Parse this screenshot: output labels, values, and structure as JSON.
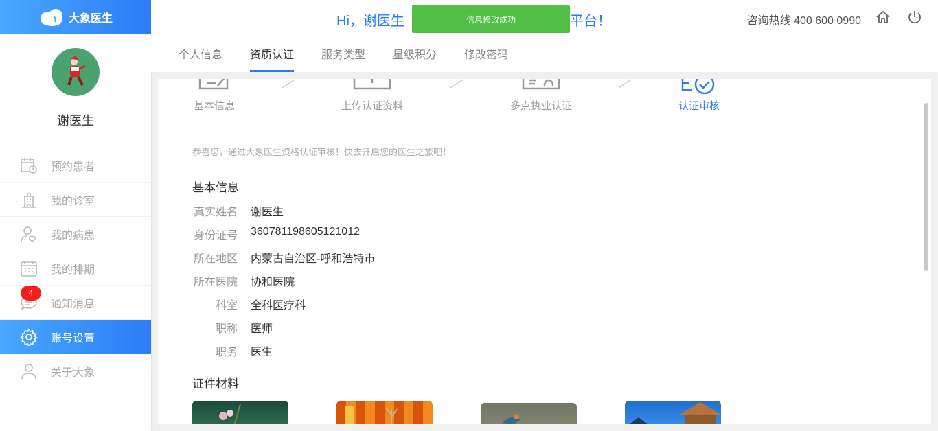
{
  "brand": {
    "name": "大象医生"
  },
  "header": {
    "greeting_left": "Hi，谢医生",
    "greeting_right": "平台！",
    "toast": "信息修改成功",
    "hotline": "咨询热线 400 600 0990"
  },
  "doctor": {
    "name": "谢医生"
  },
  "menu": [
    {
      "label": "预约患者",
      "icon": "calendar-clock-icon"
    },
    {
      "label": "我的诊室",
      "icon": "building-icon"
    },
    {
      "label": "我的病患",
      "icon": "user-heart-icon"
    },
    {
      "label": "我的排期",
      "icon": "calendar-icon"
    },
    {
      "label": "通知消息",
      "icon": "message-icon",
      "badge": "4"
    },
    {
      "label": "账号设置",
      "icon": "gear-icon",
      "active": true
    },
    {
      "label": "关于大象",
      "icon": "user-icon"
    }
  ],
  "tabs": [
    "个人信息",
    "资质认证",
    "服务类型",
    "星级积分",
    "修改密码"
  ],
  "active_tab": "资质认证",
  "steps": [
    "基本信息",
    "上传认证资料",
    "多点执业认证",
    "认证审核"
  ],
  "congrats": "恭喜您，通过大象医生资格认证审核！快去开启您的医生之旅吧！",
  "basic_info": {
    "title": "基本信息",
    "rows": [
      {
        "label": "真实姓名",
        "value": "谢医生"
      },
      {
        "label": "身份证号",
        "value": "360781198605121012"
      },
      {
        "label": "所在地区",
        "value": "内蒙古自治区-呼和浩特市"
      },
      {
        "label": "所在医院",
        "value": "协和医院"
      },
      {
        "label": "科室",
        "value": "全科医疗科"
      },
      {
        "label": "职称",
        "value": "医师"
      },
      {
        "label": "职务",
        "value": "医生"
      }
    ]
  },
  "certificates": {
    "title": "证件材料"
  },
  "colors": {
    "accent": "#2c7cf5",
    "success": "#4fc045",
    "badge": "#f41e1e",
    "avatar_bg": "#4aa36f"
  }
}
